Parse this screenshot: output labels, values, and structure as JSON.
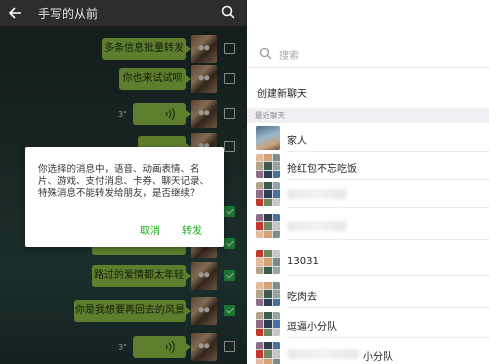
{
  "left": {
    "header": {
      "title": "手写的从前"
    },
    "messages": [
      {
        "type": "text",
        "text": "多条信息批量转发",
        "checked": false
      },
      {
        "type": "text",
        "text": "你也来试试呗",
        "checked": false
      },
      {
        "type": "voice",
        "duration": "3\"",
        "checked": false
      },
      {
        "type": "text",
        "text": "",
        "checked": false
      },
      {
        "type": "text",
        "text": "",
        "checked": true
      },
      {
        "type": "text",
        "text": "",
        "checked": true
      },
      {
        "type": "text",
        "text": "路过的爱情都太年轻",
        "checked": true
      },
      {
        "type": "text",
        "text": "你是我想要再回去的风景",
        "checked": true
      },
      {
        "type": "voice",
        "duration": "3\"",
        "checked": false
      }
    ],
    "dialog": {
      "lines": [
        "你选择的消息中，语音、动画表情、名",
        "片、游戏、支付消息、卡券、聊天记录、",
        "特殊消息不能转发给朋友，是否继续？"
      ],
      "cancel_label": "取消",
      "forward_label": "转发"
    }
  },
  "right": {
    "search_placeholder": "搜索",
    "new_chat_label": "创建新聊天",
    "recent_header": "最近聊天",
    "contacts": [
      {
        "name": "家人",
        "avatar": "single"
      },
      {
        "name": "抢红包不忘吃饭",
        "avatar": "grid"
      },
      {
        "name": "",
        "avatar": "grid",
        "blurred": true
      },
      {
        "name": "",
        "avatar": "grid",
        "blurred": true
      },
      {
        "name": "13031",
        "avatar": "grid"
      },
      {
        "name": "吃肉去",
        "avatar": "grid"
      },
      {
        "name": "逗逼小分队",
        "avatar": "grid"
      },
      {
        "name": "小分队",
        "avatar": "grid",
        "partial_blur": true
      }
    ]
  },
  "colors": {
    "bubble": "#8fc446",
    "checkbox_checked": "#2bb24c",
    "dialog_button": "#1aad19",
    "header_bg": "#2d2d2d"
  }
}
